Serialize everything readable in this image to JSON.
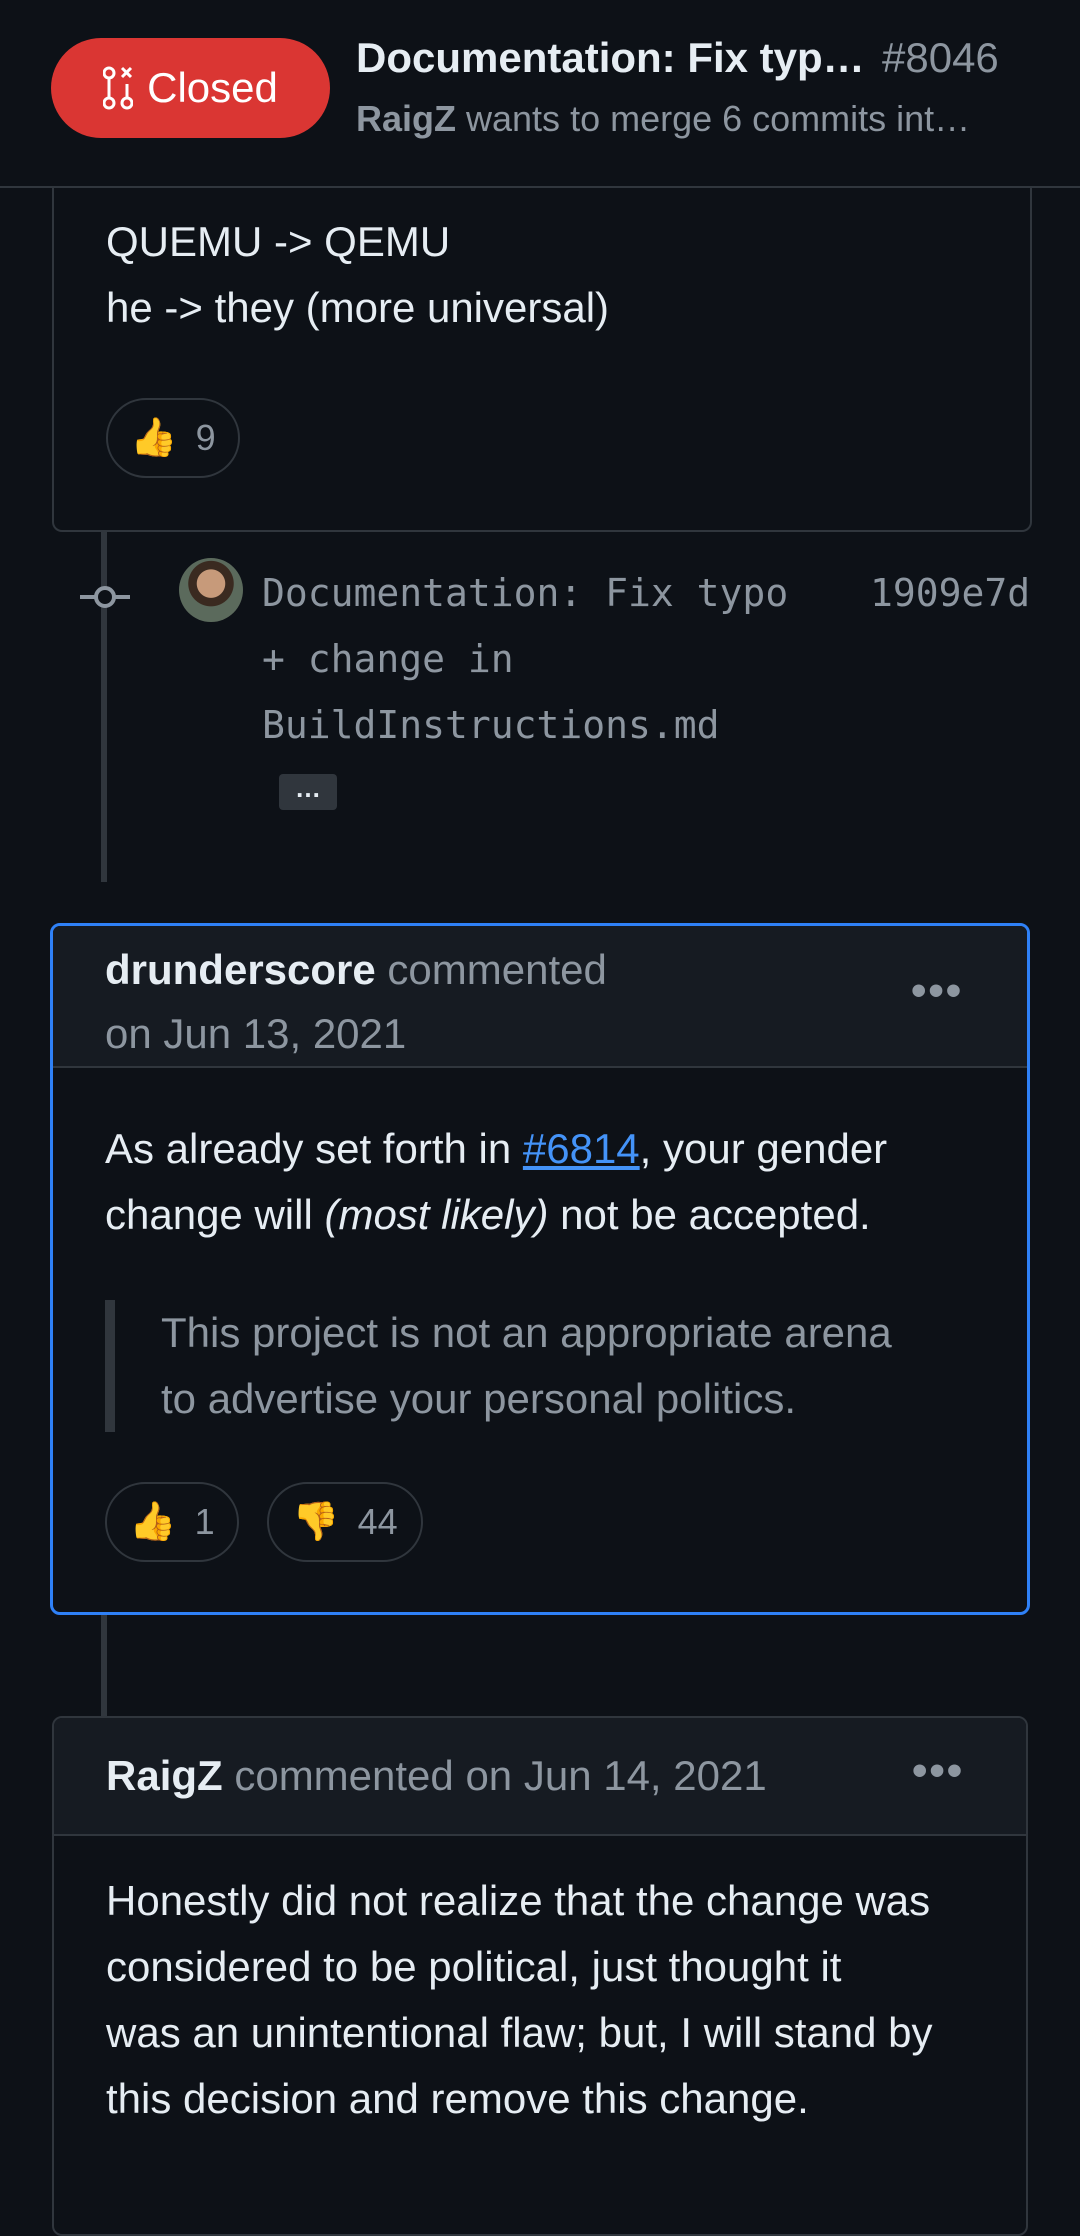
{
  "header": {
    "state": "Closed",
    "title": "Documentation: Fix typ…",
    "number": "#8046",
    "author": "RaigZ",
    "subtitle": " wants to merge 6 commits int…"
  },
  "top_comment": {
    "lines": [
      "QUEMU -> QEMU",
      "he -> they (more universal)"
    ],
    "reactions": [
      {
        "emoji": "👍",
        "count": "9"
      }
    ]
  },
  "commit": {
    "message": "Documentation: Fix typo\n+ change in\nBuildInstructions.md",
    "sha": "1909e7d",
    "expand_label": "…"
  },
  "comment1": {
    "author": "drunderscore",
    "action": " commented",
    "date": "on Jun 13, 2021",
    "menu": "•••",
    "body_prefix": "As already set forth in ",
    "link": "#6814",
    "body_mid": ", your gender",
    "body_line2_start": "change will ",
    "body_italic": "(most likely)",
    "body_line2_end": " not be accepted.",
    "quote_line1": "This project is not an appropriate arena",
    "quote_line2": "to advertise your personal politics.",
    "reactions": [
      {
        "emoji": "👍",
        "count": "1"
      },
      {
        "emoji": "👎",
        "count": "44"
      }
    ]
  },
  "comment2": {
    "author": "RaigZ",
    "action": " commented on Jun 14, 2021",
    "menu": "•••",
    "body_lines": [
      "Honestly did not realize that the change was",
      "considered to be political, just thought it",
      "was an unintentional flaw; but, I will stand by",
      "this decision and remove this change."
    ]
  },
  "colors": {
    "background": "#0d1117",
    "closed_red": "#da3633",
    "border": "#30363d",
    "highlight_blue": "#2f81f7",
    "link_blue": "#4493f8",
    "muted": "#8d96a0"
  },
  "icons": [
    "pull-request-closed-icon",
    "commit-node-icon",
    "kebab-menu-icon"
  ]
}
